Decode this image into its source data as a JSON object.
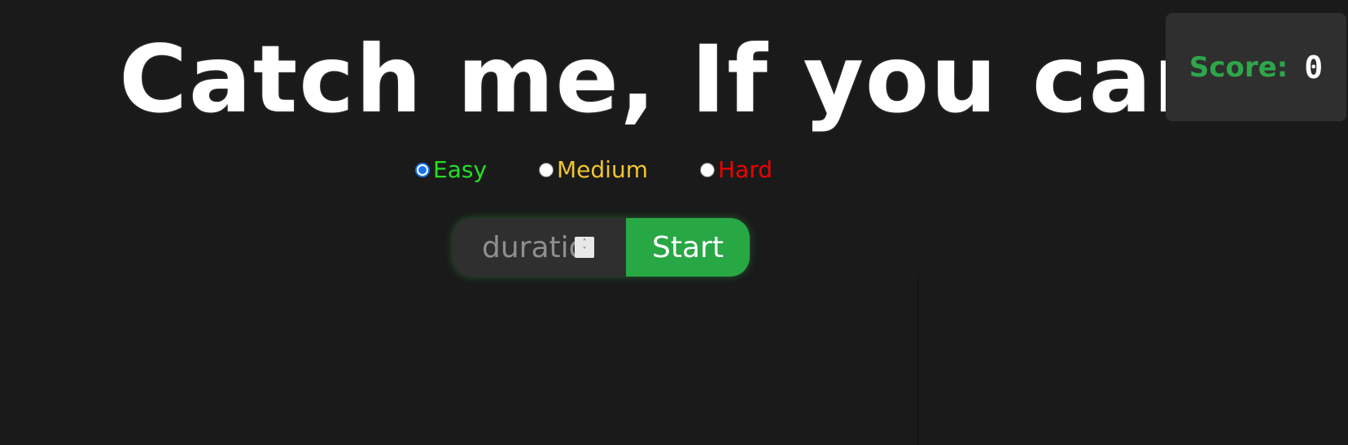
{
  "title": "Catch me, If you can",
  "score": {
    "label": "Score:",
    "value": "0"
  },
  "difficulty": {
    "selected": "Easy",
    "options": [
      {
        "label": "Easy",
        "color": "#22e022"
      },
      {
        "label": "Medium",
        "color": "#f2c431"
      },
      {
        "label": "Hard",
        "color": "#f00000"
      }
    ]
  },
  "duration": {
    "placeholder": "duration",
    "value": ""
  },
  "start_button": {
    "label": "Start"
  },
  "colors": {
    "background": "#1a1a1a",
    "panel": "#2f2f2f",
    "accent": "#28a745",
    "score_label": "#2ea64a",
    "radio_checked": "#1a73e8"
  }
}
